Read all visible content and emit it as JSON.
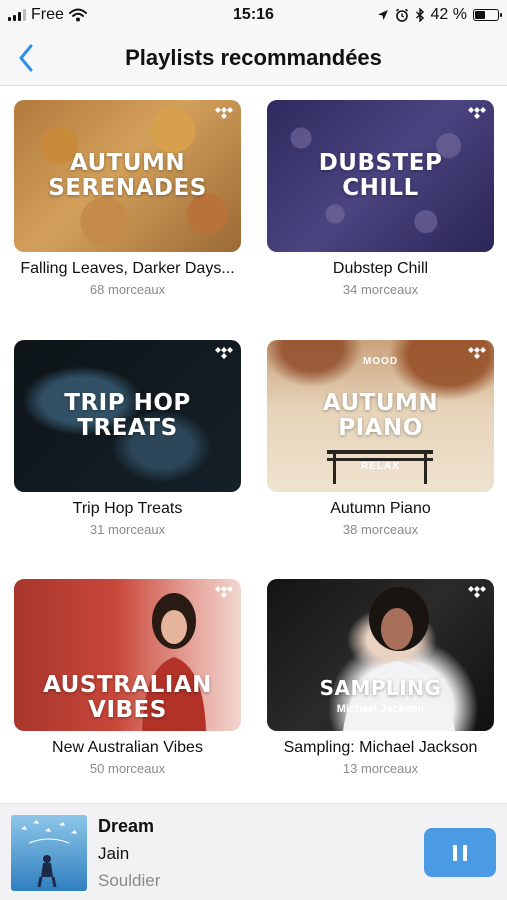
{
  "status_bar": {
    "carrier": "Free",
    "time": "15:16",
    "battery": "42 %",
    "battery_level": 0.42,
    "icons": [
      "signal-icon",
      "wifi-icon",
      "location-icon",
      "alarm-icon",
      "bluetooth-icon",
      "battery-icon"
    ]
  },
  "nav": {
    "title": "Playlists recommandées",
    "back_icon": "chevron-left-icon",
    "accent_color": "#2f8fe8"
  },
  "playlists": [
    {
      "cover_title": "AUTUMN\nSERENADES",
      "name": "Falling Leaves, Darker Days...",
      "count": "68 morceaux"
    },
    {
      "cover_title": "DUBSTEP\nCHILL",
      "name": "Dubstep Chill",
      "count": "34 morceaux"
    },
    {
      "cover_title": "TRIP HOP\nTREATS",
      "name": "Trip Hop Treats",
      "count": "31 morceaux"
    },
    {
      "cover_title": "AUTUMN\nPIANO",
      "cover_top": "MOOD",
      "cover_bottom": "RELAX",
      "name": "Autumn Piano",
      "count": "38 morceaux"
    },
    {
      "cover_title": "AUSTRALIAN\nVIBES",
      "name": "New Australian Vibes",
      "count": "50 morceaux"
    },
    {
      "cover_title": "SAMPLING",
      "cover_subtitle": "Michael Jackson",
      "name": "Sampling: Michael Jackson",
      "count": "13 morceaux"
    }
  ],
  "now_playing": {
    "title": "Dream",
    "artist": "Jain",
    "album": "Souldier",
    "pause_icon": "pause-icon",
    "button_color": "#4a9be4"
  }
}
